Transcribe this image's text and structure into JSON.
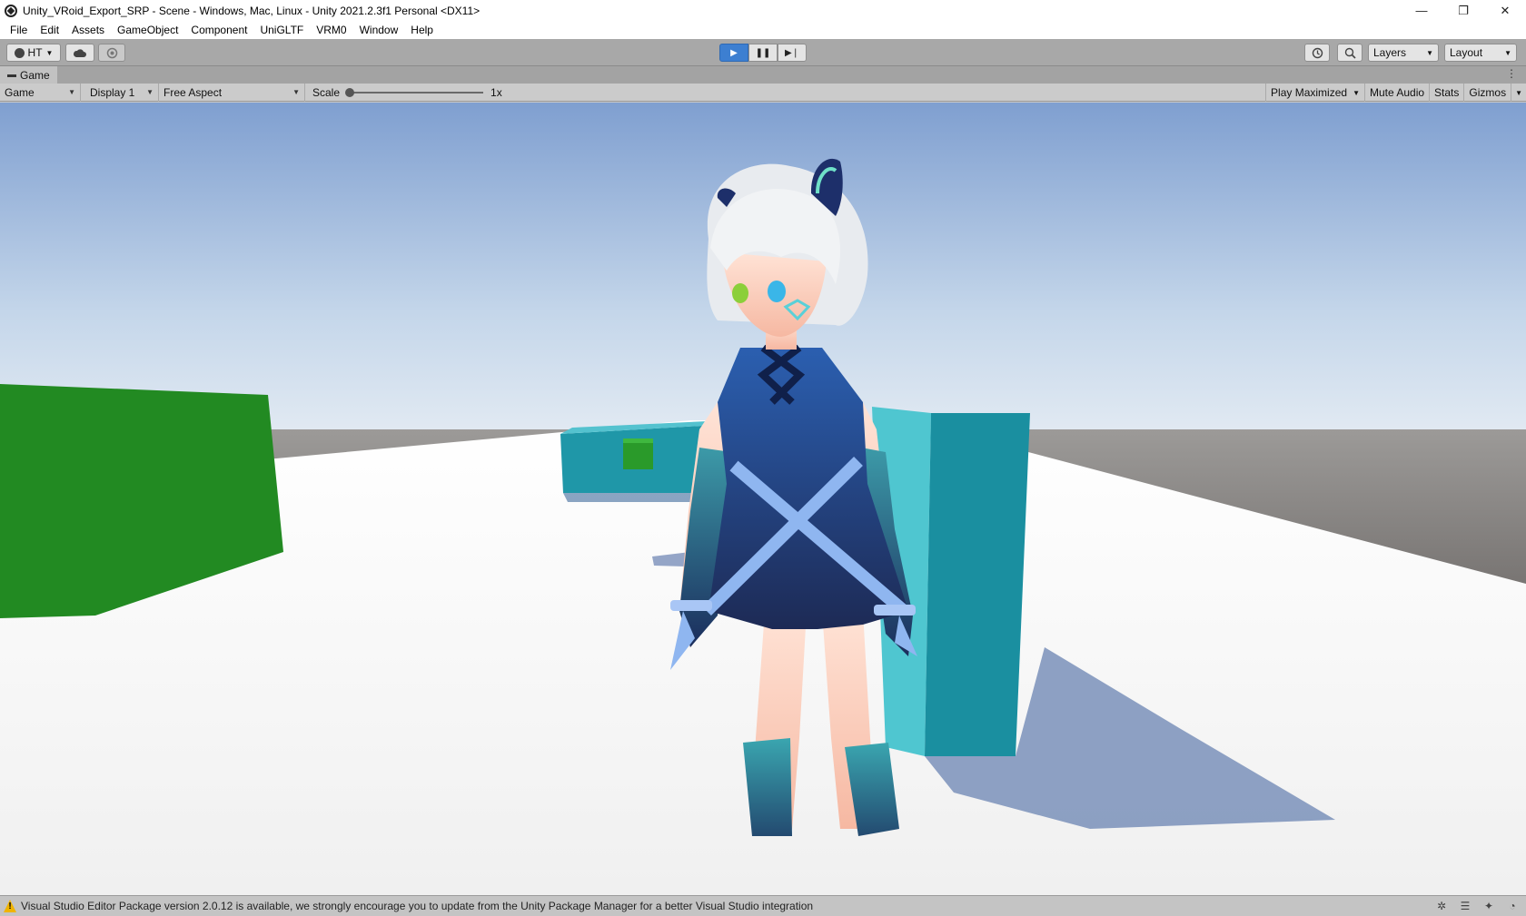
{
  "window": {
    "title": "Unity_VRoid_Export_SRP - Scene - Windows, Mac, Linux - Unity 2021.2.3f1 Personal <DX11>",
    "controls": {
      "minimize": "—",
      "restore": "❐",
      "close": "✕"
    }
  },
  "menu": [
    "File",
    "Edit",
    "Assets",
    "GameObject",
    "Component",
    "UniGLTF",
    "VRM0",
    "Window",
    "Help"
  ],
  "toolbar": {
    "account_label": "HT",
    "play": "▶",
    "pause": "❚❚",
    "step": "▶❘",
    "layers_label": "Layers",
    "layout_label": "Layout"
  },
  "tab": {
    "label": "Game",
    "menu_glyph": "⋮"
  },
  "gamebar": {
    "view_select": "Game",
    "display_select": "Display 1",
    "aspect_select": "Free Aspect",
    "scale_label": "Scale",
    "scale_value": "1x",
    "scale_slider_fraction": 0,
    "play_maximized": "Play Maximized",
    "mute_audio": "Mute Audio",
    "stats": "Stats",
    "gizmos": "Gizmos"
  },
  "status": {
    "message": "Visual Studio Editor Package version 2.0.12 is available, we strongly encourage you to update from the Unity Package Manager for a better Visual Studio integration"
  },
  "colors": {
    "play_active": "#3d7fd1",
    "sky_top": "#7f9fd0",
    "floor": "#f2f2f2",
    "green_cube": "#228a22",
    "teal_cube": "#1a8fa0"
  },
  "icons": [
    "unity-logo-icon",
    "account-icon",
    "cloud-icon",
    "collab-icon",
    "history-icon",
    "search-icon",
    "warning-icon"
  ]
}
